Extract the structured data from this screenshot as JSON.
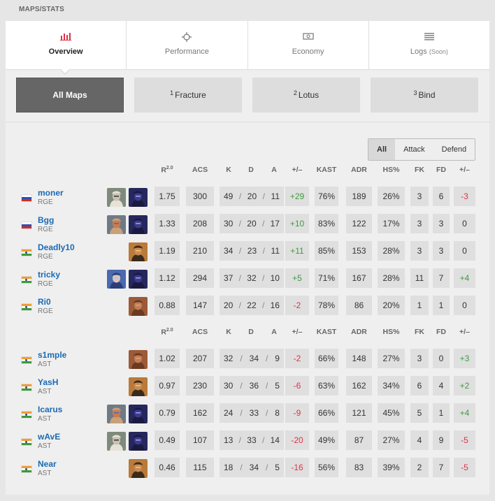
{
  "section_title": "MAPS/STATS",
  "tabs": [
    {
      "label": "Overview",
      "icon": "bar-chart-icon",
      "active": true
    },
    {
      "label": "Performance",
      "icon": "crosshair-icon",
      "active": false
    },
    {
      "label": "Economy",
      "icon": "money-icon",
      "active": false
    },
    {
      "label": "Logs",
      "suffix": "(Soon)",
      "icon": "list-icon",
      "active": false
    }
  ],
  "maps": [
    {
      "num": "",
      "label": "All Maps",
      "active": true
    },
    {
      "num": "1",
      "label": "Fracture",
      "active": false
    },
    {
      "num": "2",
      "label": "Lotus",
      "active": false
    },
    {
      "num": "3",
      "label": "Bind",
      "active": false
    }
  ],
  "side_filter": [
    "All",
    "Attack",
    "Defend"
  ],
  "headers": {
    "rating": "R",
    "rating_sup": "2.0",
    "acs": "ACS",
    "k": "K",
    "d": "D",
    "a": "A",
    "pm": "+/–",
    "kast": "KAST",
    "adr": "ADR",
    "hs": "HS%",
    "fk": "FK",
    "fd": "FD",
    "fpm": "+/–"
  },
  "teams": [
    {
      "players": [
        {
          "name": "moner",
          "team": "RGE",
          "flag": "ru",
          "agents": [
            "cypher",
            "omen"
          ],
          "rating": "1.75",
          "acs": "300",
          "k": "49",
          "d": "20",
          "a": "11",
          "pm": "+29",
          "kast": "76%",
          "adr": "189",
          "hs": "26%",
          "fk": "3",
          "fd": "6",
          "fpm": "-3"
        },
        {
          "name": "Bgg",
          "team": "RGE",
          "flag": "ru",
          "agents": [
            "kayo",
            "omen"
          ],
          "rating": "1.33",
          "acs": "208",
          "k": "30",
          "d": "20",
          "a": "17",
          "pm": "+10",
          "kast": "83%",
          "adr": "122",
          "hs": "17%",
          "fk": "3",
          "fd": "3",
          "fpm": "0"
        },
        {
          "name": "Deadly10",
          "team": "RGE",
          "flag": "in",
          "agents": [
            "phoenix"
          ],
          "rating": "1.19",
          "acs": "210",
          "k": "34",
          "d": "23",
          "a": "11",
          "pm": "+11",
          "kast": "85%",
          "adr": "153",
          "hs": "28%",
          "fk": "3",
          "fd": "3",
          "fpm": "0"
        },
        {
          "name": "tricky",
          "team": "RGE",
          "flag": "in",
          "agents": [
            "jett",
            "omen"
          ],
          "rating": "1.12",
          "acs": "294",
          "k": "37",
          "d": "32",
          "a": "10",
          "pm": "+5",
          "kast": "71%",
          "adr": "167",
          "hs": "28%",
          "fk": "11",
          "fd": "7",
          "fpm": "+4"
        },
        {
          "name": "Ri0",
          "team": "RGE",
          "flag": "in",
          "agents": [
            "breach"
          ],
          "rating": "0.88",
          "acs": "147",
          "k": "20",
          "d": "22",
          "a": "16",
          "pm": "-2",
          "kast": "78%",
          "adr": "86",
          "hs": "20%",
          "fk": "1",
          "fd": "1",
          "fpm": "0"
        }
      ]
    },
    {
      "players": [
        {
          "name": "s1mple",
          "team": "AST",
          "flag": "in",
          "agents": [
            "breach"
          ],
          "rating": "1.02",
          "acs": "207",
          "k": "32",
          "d": "34",
          "a": "9",
          "pm": "-2",
          "kast": "66%",
          "adr": "148",
          "hs": "27%",
          "fk": "3",
          "fd": "0",
          "fpm": "+3"
        },
        {
          "name": "YasH",
          "team": "AST",
          "flag": "in",
          "agents": [
            "phoenix"
          ],
          "rating": "0.97",
          "acs": "230",
          "k": "30",
          "d": "36",
          "a": "5",
          "pm": "-6",
          "kast": "63%",
          "adr": "162",
          "hs": "34%",
          "fk": "6",
          "fd": "4",
          "fpm": "+2"
        },
        {
          "name": "Icarus",
          "team": "AST",
          "flag": "in",
          "agents": [
            "kayo",
            "omen"
          ],
          "rating": "0.79",
          "acs": "162",
          "k": "24",
          "d": "33",
          "a": "8",
          "pm": "-9",
          "kast": "66%",
          "adr": "121",
          "hs": "45%",
          "fk": "5",
          "fd": "1",
          "fpm": "+4"
        },
        {
          "name": "wAvE",
          "team": "AST",
          "flag": "in",
          "agents": [
            "cypher",
            "omen"
          ],
          "rating": "0.49",
          "acs": "107",
          "k": "13",
          "d": "33",
          "a": "14",
          "pm": "-20",
          "kast": "49%",
          "adr": "87",
          "hs": "27%",
          "fk": "4",
          "fd": "9",
          "fpm": "-5"
        },
        {
          "name": "Near",
          "team": "AST",
          "flag": "in",
          "agents": [
            "phoenix"
          ],
          "rating": "0.46",
          "acs": "115",
          "k": "18",
          "d": "34",
          "a": "5",
          "pm": "-16",
          "kast": "56%",
          "adr": "83",
          "hs": "39%",
          "fk": "2",
          "fd": "7",
          "fpm": "-5"
        }
      ]
    }
  ]
}
